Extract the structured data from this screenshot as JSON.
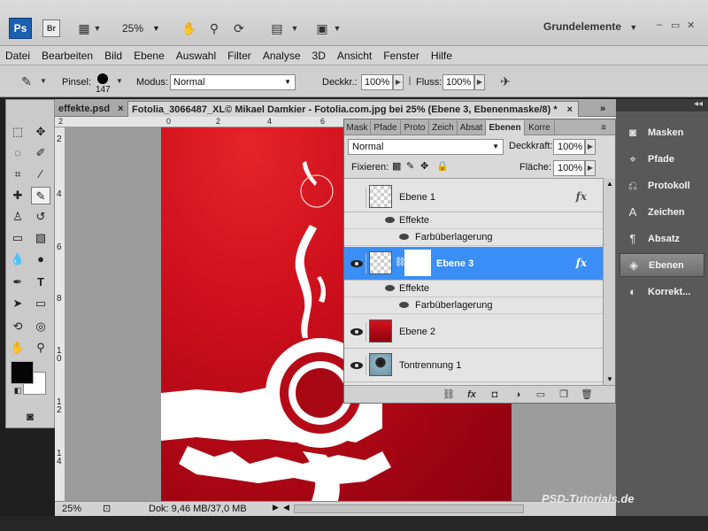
{
  "appbar": {
    "logo": "Ps",
    "bridge": "Br",
    "zoom": "25%",
    "workspace": "Grundelemente",
    "window_buttons": [
      "–",
      "▭",
      "✕"
    ]
  },
  "menu": [
    "Datei",
    "Bearbeiten",
    "Bild",
    "Ebene",
    "Auswahl",
    "Filter",
    "Analyse",
    "3D",
    "Ansicht",
    "Fenster",
    "Hilfe"
  ],
  "options": {
    "brush_label": "Pinsel:",
    "brush_size": "147",
    "mode_label": "Modus:",
    "mode_value": "Normal",
    "opacity_label": "Deckkr.:",
    "opacity_value": "100%",
    "flow_label": "Fluss:",
    "flow_value": "100%"
  },
  "tabs": [
    {
      "label": "effekte.psd",
      "active": false
    },
    {
      "label": "Fotolia_3066487_XL© Mikael Damkier - Fotolia.com.jpg bei 25% (Ebene 3, Ebenenmaske/8) *",
      "active": true
    }
  ],
  "tab_close": "×",
  "tab_more": "»",
  "ruler": {
    "top": [
      "2",
      "0",
      "2",
      "4",
      "6"
    ],
    "left": [
      "2",
      "4",
      "6",
      "8",
      "1\n0",
      "1\n2",
      "1\n4"
    ]
  },
  "layers_panel": {
    "tabs": [
      "Mask",
      "Pfade",
      "Proto",
      "Zeich",
      "Absat",
      "Ebenen",
      "Korre"
    ],
    "active_tab": "Ebenen",
    "blend_mode": "Normal",
    "opacity_label": "Deckkraft:",
    "opacity_value": "100%",
    "lock_label": "Fixieren:",
    "fill_label": "Fläche:",
    "fill_value": "100%",
    "layers": [
      {
        "name": "Ebene 1",
        "visible": false,
        "selected": false,
        "fx": "fx",
        "effects_label": "Effekte",
        "effects": [
          "Farbüberlagerung"
        ]
      },
      {
        "name": "Ebene 3",
        "visible": true,
        "selected": true,
        "fx": "fx",
        "effects_label": "Effekte",
        "effects": [
          "Farbüberlagerung"
        ]
      },
      {
        "name": "Ebene 2",
        "visible": true,
        "selected": false
      },
      {
        "name": "Tontrennung 1",
        "visible": true,
        "selected": false
      }
    ]
  },
  "dock": {
    "items": [
      {
        "label": "Masken",
        "icon": "masks-icon"
      },
      {
        "label": "Pfade",
        "icon": "paths-icon"
      },
      {
        "label": "Protokoll",
        "icon": "history-icon"
      },
      {
        "label": "Zeichen",
        "icon": "character-icon"
      },
      {
        "label": "Absatz",
        "icon": "paragraph-icon"
      },
      {
        "label": "Ebenen",
        "icon": "layers-icon"
      },
      {
        "label": "Korrekt...",
        "icon": "adjustments-icon"
      }
    ],
    "active": "Ebenen"
  },
  "status": {
    "zoom": "25%",
    "doc_info": "Dok: 9,46 MB/37,0 MB"
  },
  "watermark": "PSD-Tutorials.de",
  "colors": {
    "accent": "#3b8ef5",
    "image_red": "#c80f1c",
    "foreground": "#050505",
    "background": "#ffffff"
  }
}
